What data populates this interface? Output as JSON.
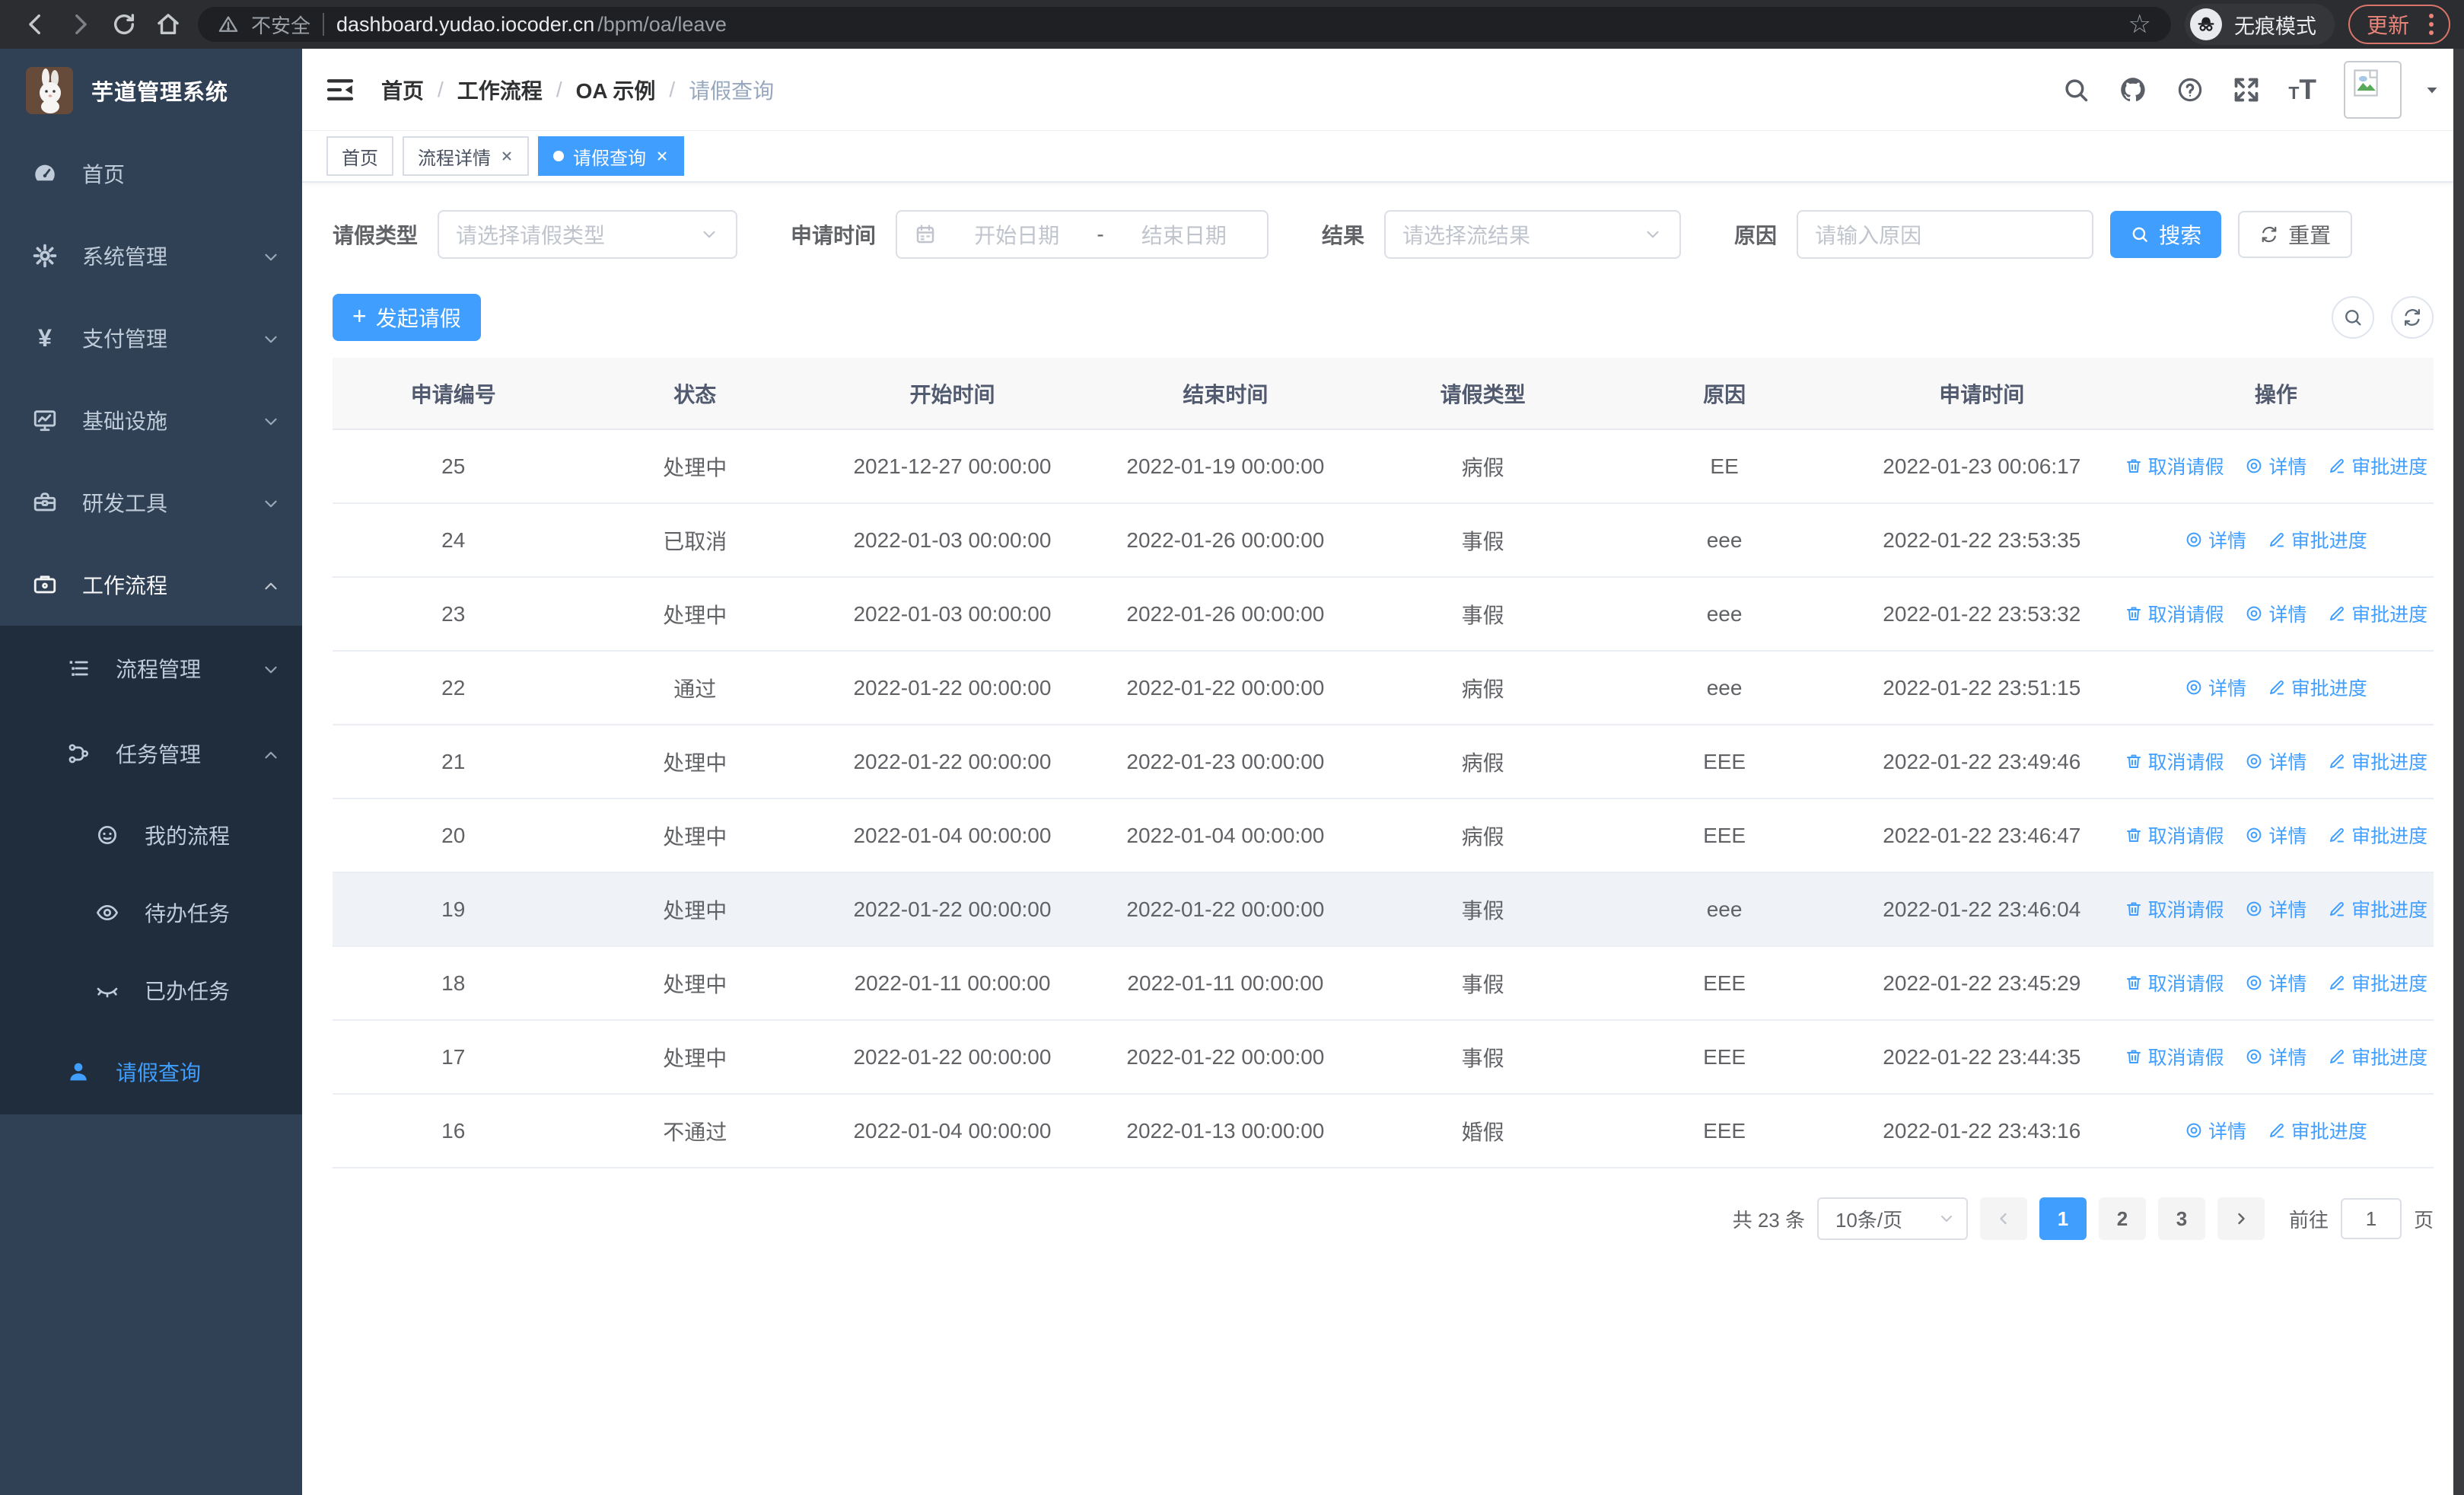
{
  "browser": {
    "security_label": "不安全",
    "url_host": "dashboard.yudao.iocoder.cn",
    "url_path": "/bpm/oa/leave",
    "incognito_label": "无痕模式",
    "update_label": "更新"
  },
  "sidebar": {
    "title": "芋道管理系统",
    "menu": [
      {
        "label": "首页"
      },
      {
        "label": "系统管理"
      },
      {
        "label": "支付管理"
      },
      {
        "label": "基础设施"
      },
      {
        "label": "研发工具"
      },
      {
        "label": "工作流程"
      }
    ],
    "workflow_children": [
      {
        "label": "流程管理"
      },
      {
        "label": "任务管理"
      }
    ],
    "task_children": [
      {
        "label": "我的流程"
      },
      {
        "label": "待办任务"
      },
      {
        "label": "已办任务"
      }
    ],
    "active_item": {
      "label": "请假查询"
    }
  },
  "header": {
    "breadcrumb": [
      "首页",
      "工作流程",
      "OA 示例",
      "请假查询"
    ],
    "separator": "/"
  },
  "tabs": [
    {
      "label": "首页"
    },
    {
      "label": "流程详情"
    },
    {
      "label": "请假查询"
    }
  ],
  "filters": {
    "leave_type_label": "请假类型",
    "leave_type_placeholder": "请选择请假类型",
    "apply_time_label": "申请时间",
    "date_start_placeholder": "开始日期",
    "date_separator": "-",
    "date_end_placeholder": "结束日期",
    "result_label": "结果",
    "result_placeholder": "请选择流结果",
    "reason_label": "原因",
    "reason_placeholder": "请输入原因",
    "search_button": "搜索",
    "reset_button": "重置"
  },
  "actions": {
    "create_button": "发起请假"
  },
  "table": {
    "columns": [
      "申请编号",
      "状态",
      "开始时间",
      "结束时间",
      "请假类型",
      "原因",
      "申请时间",
      "操作"
    ],
    "action_labels": {
      "cancel": "取消请假",
      "detail": "详情",
      "progress": "审批进度"
    },
    "rows": [
      {
        "id": "25",
        "status": "处理中",
        "start": "2021-12-27 00:00:00",
        "end": "2022-01-19 00:00:00",
        "type": "病假",
        "reason": "EE",
        "apply": "2022-01-23 00:06:17"
      },
      {
        "id": "24",
        "status": "已取消",
        "start": "2022-01-03 00:00:00",
        "end": "2022-01-26 00:00:00",
        "type": "事假",
        "reason": "eee",
        "apply": "2022-01-22 23:53:35"
      },
      {
        "id": "23",
        "status": "处理中",
        "start": "2022-01-03 00:00:00",
        "end": "2022-01-26 00:00:00",
        "type": "事假",
        "reason": "eee",
        "apply": "2022-01-22 23:53:32"
      },
      {
        "id": "22",
        "status": "通过",
        "start": "2022-01-22 00:00:00",
        "end": "2022-01-22 00:00:00",
        "type": "病假",
        "reason": "eee",
        "apply": "2022-01-22 23:51:15"
      },
      {
        "id": "21",
        "status": "处理中",
        "start": "2022-01-22 00:00:00",
        "end": "2022-01-23 00:00:00",
        "type": "病假",
        "reason": "EEE",
        "apply": "2022-01-22 23:49:46"
      },
      {
        "id": "20",
        "status": "处理中",
        "start": "2022-01-04 00:00:00",
        "end": "2022-01-04 00:00:00",
        "type": "病假",
        "reason": "EEE",
        "apply": "2022-01-22 23:46:47"
      },
      {
        "id": "19",
        "status": "处理中",
        "start": "2022-01-22 00:00:00",
        "end": "2022-01-22 00:00:00",
        "type": "事假",
        "reason": "eee",
        "apply": "2022-01-22 23:46:04"
      },
      {
        "id": "18",
        "status": "处理中",
        "start": "2022-01-11 00:00:00",
        "end": "2022-01-11 00:00:00",
        "type": "事假",
        "reason": "EEE",
        "apply": "2022-01-22 23:45:29"
      },
      {
        "id": "17",
        "status": "处理中",
        "start": "2022-01-22 00:00:00",
        "end": "2022-01-22 00:00:00",
        "type": "事假",
        "reason": "EEE",
        "apply": "2022-01-22 23:44:35"
      },
      {
        "id": "16",
        "status": "不通过",
        "start": "2022-01-04 00:00:00",
        "end": "2022-01-13 00:00:00",
        "type": "婚假",
        "reason": "EEE",
        "apply": "2022-01-22 23:43:16"
      }
    ]
  },
  "pagination": {
    "total": "共 23 条",
    "page_size": "10条/页",
    "pages": [
      "1",
      "2",
      "3"
    ],
    "active_page": "1",
    "goto_label": "前往",
    "goto_value": "1",
    "goto_suffix": "页"
  },
  "colors": {
    "primary": "#409eff",
    "sidebar_bg": "#304156",
    "submenu_bg": "#1f2d3d",
    "table_header_bg": "#f8f8f9",
    "update_accent": "#e8847a"
  }
}
